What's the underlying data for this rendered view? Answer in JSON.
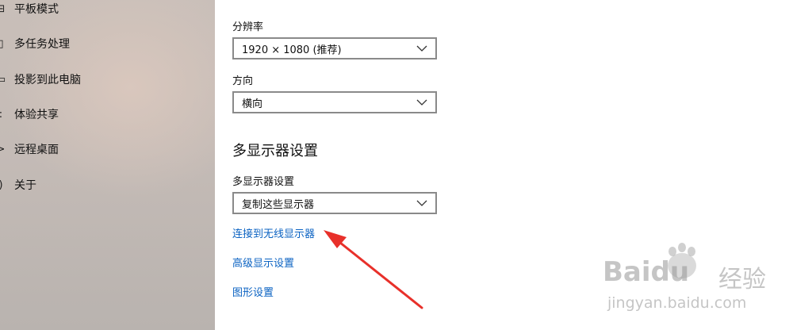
{
  "sidebar": {
    "items": [
      {
        "label": "平板模式",
        "icon": "tablet-icon"
      },
      {
        "label": "多任务处理",
        "icon": "multitasking-icon"
      },
      {
        "label": "投影到此电脑",
        "icon": "project-icon"
      },
      {
        "label": "体验共享",
        "icon": "share-icon"
      },
      {
        "label": "远程桌面",
        "icon": "remote-desktop-icon"
      },
      {
        "label": "关于",
        "icon": "info-icon"
      }
    ]
  },
  "display": {
    "resolution_label": "分辨率",
    "resolution_value": "1920 × 1080 (推荐)",
    "orientation_label": "方向",
    "orientation_value": "横向",
    "multi_display_heading": "多显示器设置",
    "multi_display_label": "多显示器设置",
    "multi_display_value": "复制这些显示器",
    "links": {
      "connect_wireless": "连接到无线显示器",
      "advanced_display": "高级显示设置",
      "graphics": "图形设置"
    }
  },
  "annotation": {
    "arrow_color": "#e8302a"
  },
  "watermark": {
    "brand": "Baidu",
    "brand_cn": "经验",
    "url": "jingyan.baidu.com"
  }
}
